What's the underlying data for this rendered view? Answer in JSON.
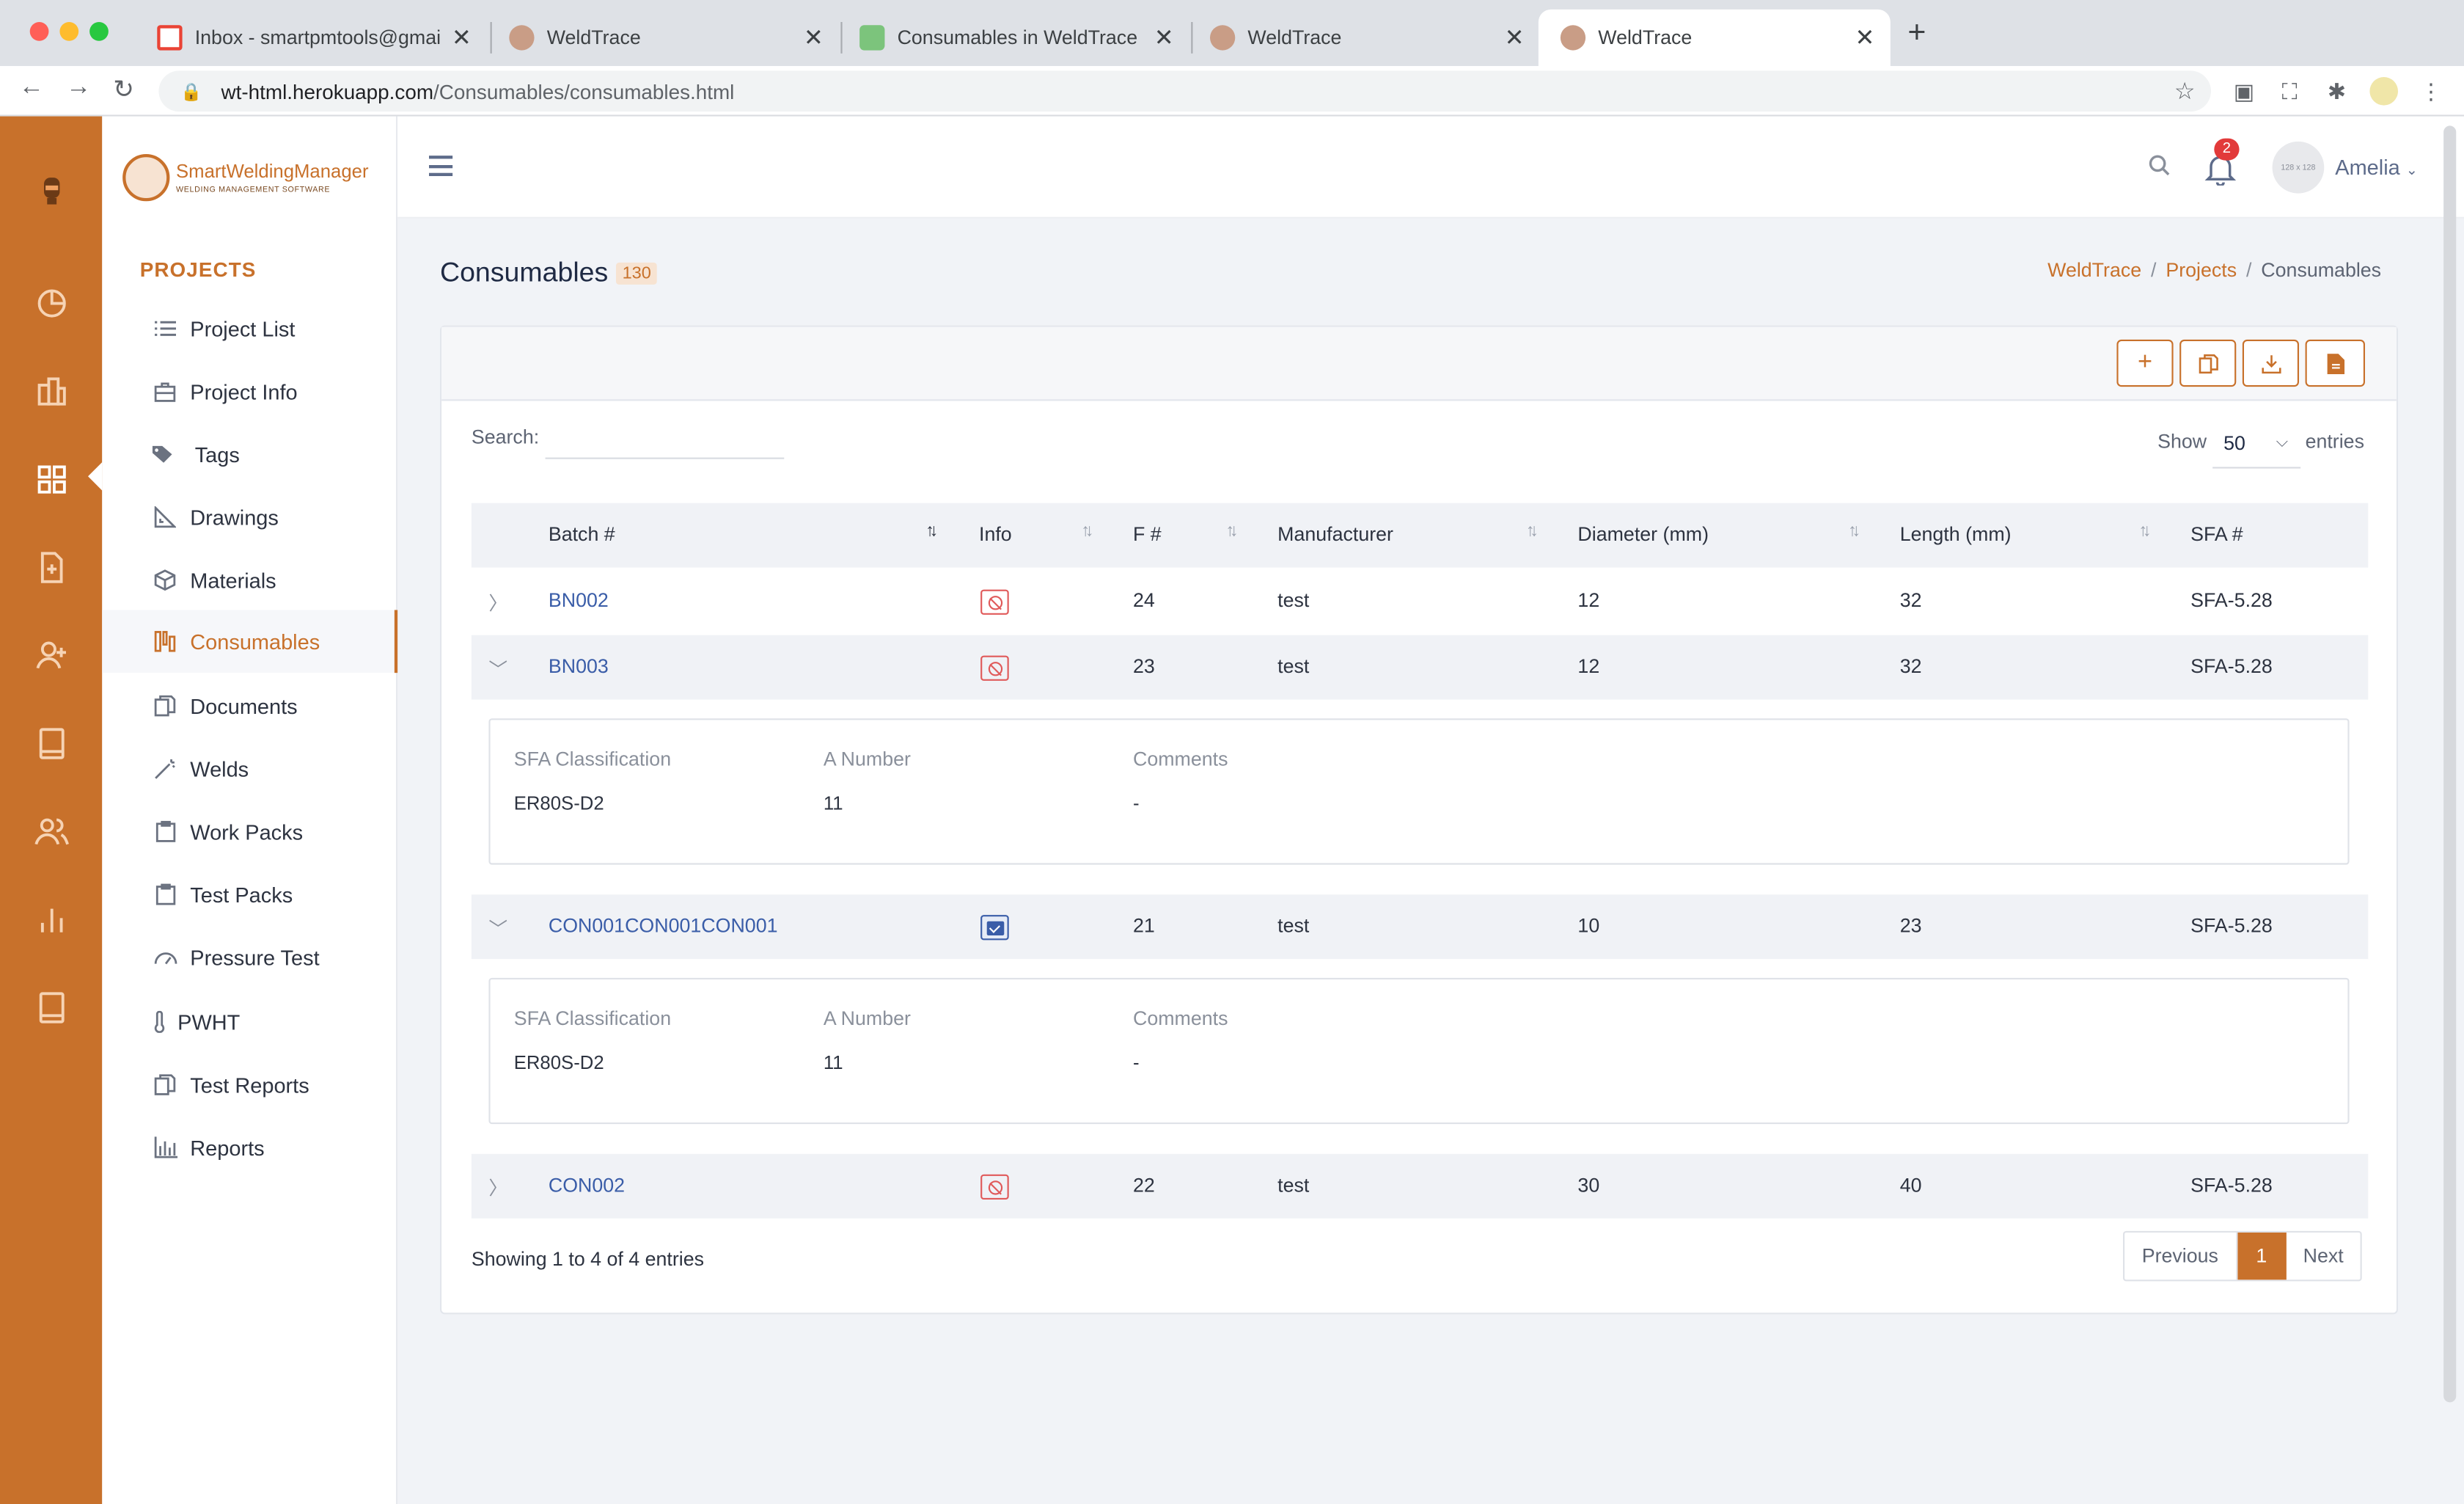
{
  "browser": {
    "tabs": [
      {
        "title": "Inbox - smartpmtools@gmail.com"
      },
      {
        "title": "WeldTrace"
      },
      {
        "title": "Consumables in WeldTrace"
      },
      {
        "title": "WeldTrace"
      },
      {
        "title": "WeldTrace"
      }
    ],
    "url_host": "wt-html.herokuapp.com",
    "url_path": "/Consumables/consumables.html"
  },
  "logo": {
    "name": "SmartWeldingManager",
    "tagline": "WELDING MANAGEMENT SOFTWARE"
  },
  "sidebar": {
    "section": "PROJECTS",
    "items": [
      {
        "label": "Project List",
        "icon": "list-icon"
      },
      {
        "label": "Project Info",
        "icon": "briefcase-icon"
      },
      {
        "label": "Tags",
        "icon": "tags-icon"
      },
      {
        "label": "Drawings",
        "icon": "ruler-icon"
      },
      {
        "label": "Materials",
        "icon": "box-icon"
      },
      {
        "label": "Consumables",
        "icon": "rods-icon"
      },
      {
        "label": "Documents",
        "icon": "documents-icon"
      },
      {
        "label": "Welds",
        "icon": "wand-icon"
      },
      {
        "label": "Work Packs",
        "icon": "clipboard-icon"
      },
      {
        "label": "Test Packs",
        "icon": "clipboard-icon"
      },
      {
        "label": "Pressure Test",
        "icon": "gauge-icon"
      },
      {
        "label": "PWHT",
        "icon": "thermometer-icon"
      },
      {
        "label": "Test Reports",
        "icon": "reports-icon"
      },
      {
        "label": "Reports",
        "icon": "chart-icon"
      }
    ]
  },
  "header": {
    "avatar_text": "128 x 128",
    "user": "Amelia",
    "notifications": "2"
  },
  "page": {
    "title": "Consumables",
    "count": "130"
  },
  "breadcrumb": {
    "items": [
      "WeldTrace",
      "Projects",
      "Consumables"
    ]
  },
  "table": {
    "search_label": "Search:",
    "search_value": "",
    "show_label": "Show",
    "page_size": "50",
    "entries_label": "entries",
    "columns": [
      "Batch #",
      "Info",
      "F #",
      "Manufacturer",
      "Diameter (mm)",
      "Length (mm)",
      "SFA #"
    ],
    "rows": [
      {
        "batch": "BN002",
        "info": "blocked",
        "f": "24",
        "manufacturer": "test",
        "diameter": "12",
        "length": "32",
        "sfa": "SFA-5.28",
        "expanded": false
      },
      {
        "batch": "BN003",
        "info": "blocked",
        "f": "23",
        "manufacturer": "test",
        "diameter": "12",
        "length": "32",
        "sfa": "SFA-5.28",
        "expanded": true,
        "detail": {
          "labels": [
            "SFA Classification",
            "A Number",
            "Comments"
          ],
          "values": [
            "ER80S-D2",
            "11",
            "-"
          ]
        }
      },
      {
        "batch": "CON001CON001CON001",
        "info": "approved",
        "f": "21",
        "manufacturer": "test",
        "diameter": "10",
        "length": "23",
        "sfa": "SFA-5.28",
        "expanded": true,
        "detail": {
          "labels": [
            "SFA Classification",
            "A Number",
            "Comments"
          ],
          "values": [
            "ER80S-D2",
            "11",
            "-"
          ]
        }
      },
      {
        "batch": "CON002",
        "info": "blocked",
        "f": "22",
        "manufacturer": "test",
        "diameter": "30",
        "length": "40",
        "sfa": "SFA-5.28",
        "expanded": false
      }
    ],
    "summary": "Showing 1 to 4 of 4 entries",
    "pagination": {
      "previous": "Previous",
      "current": "1",
      "next": "Next"
    }
  },
  "colors": {
    "brand": "#c8712b",
    "link": "#3a5da8",
    "danger": "#e05a5a"
  }
}
